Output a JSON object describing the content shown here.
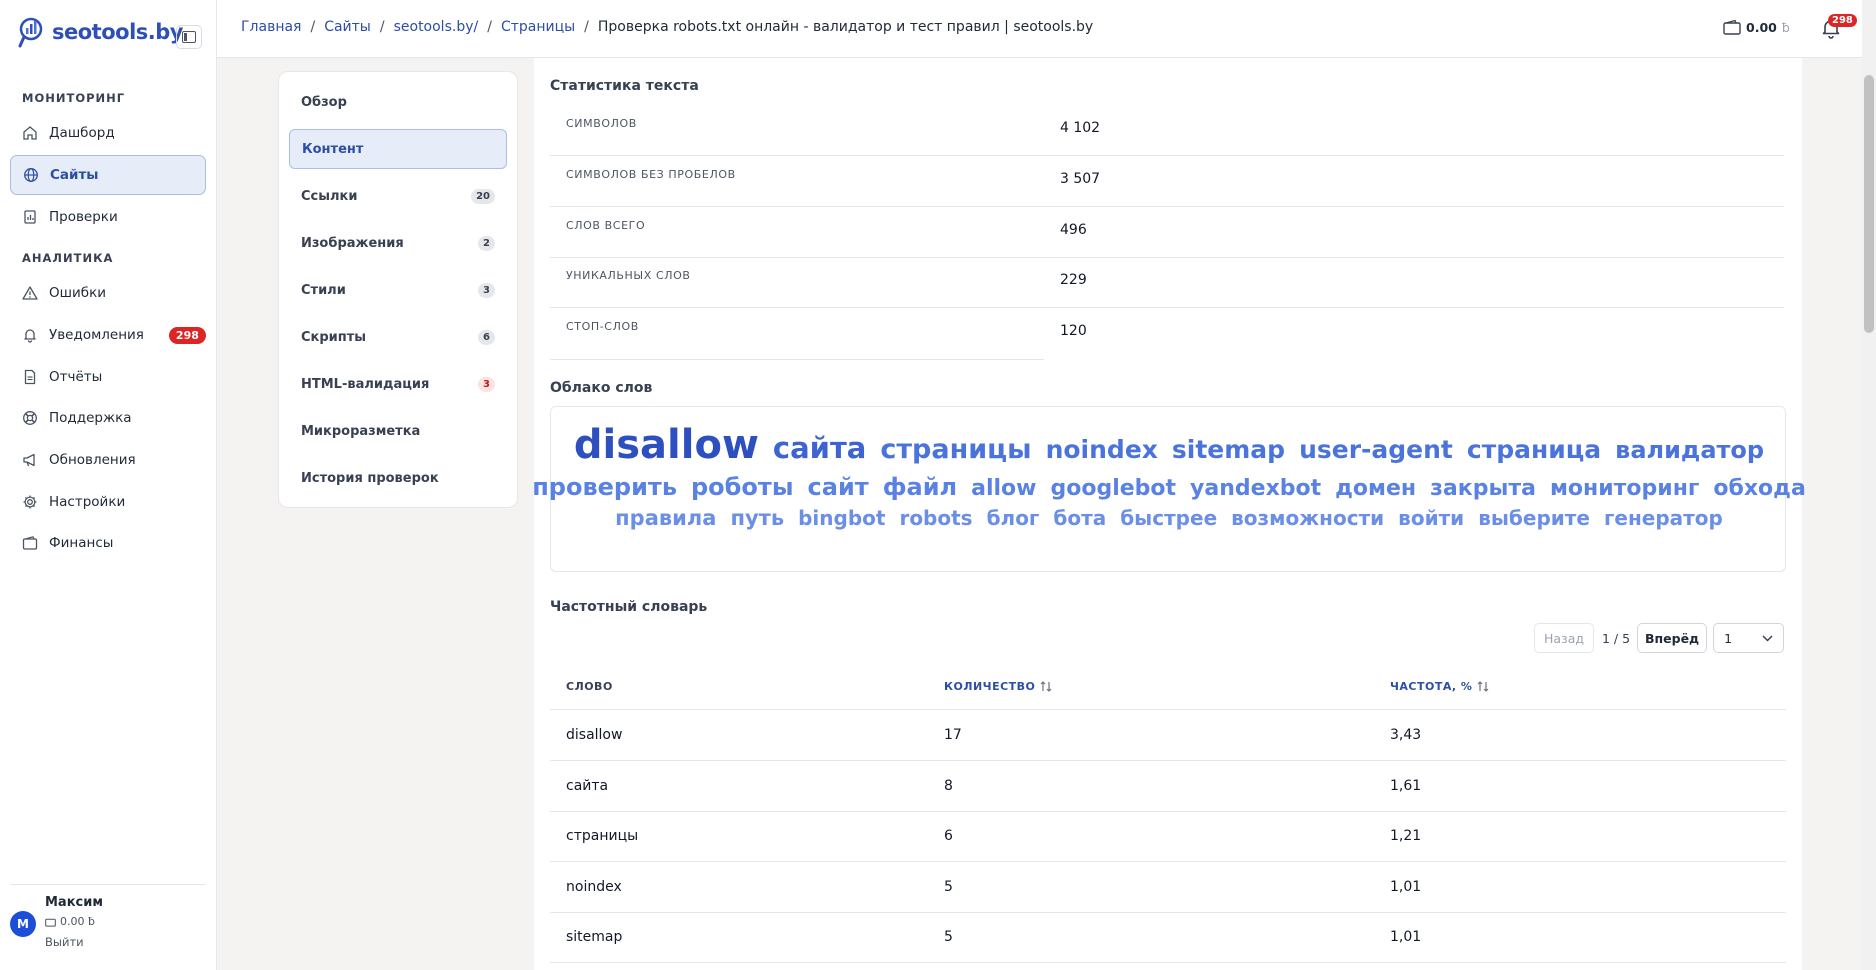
{
  "brand": {
    "name": "seotools.by"
  },
  "sidebar": {
    "sections": [
      {
        "title": "МОНИТОРИНГ"
      },
      {
        "title": "АНАЛИТИКА"
      }
    ],
    "items": [
      {
        "label": "Дашборд",
        "icon": "home-icon"
      },
      {
        "label": "Сайты",
        "icon": "globe-icon",
        "active": true
      },
      {
        "label": "Проверки",
        "icon": "report-icon"
      },
      {
        "label": "Ошибки",
        "icon": "warning-icon"
      },
      {
        "label": "Уведомления",
        "icon": "bell-icon",
        "badge": "298"
      },
      {
        "label": "Отчёты",
        "icon": "document-icon"
      },
      {
        "label": "Поддержка",
        "icon": "lifebuoy-icon"
      },
      {
        "label": "Обновления",
        "icon": "megaphone-icon"
      },
      {
        "label": "Настройки",
        "icon": "gear-icon"
      },
      {
        "label": "Финансы",
        "icon": "wallet-icon"
      }
    ],
    "user": {
      "initial": "М",
      "name": "Максим",
      "balance": "0.00 ƀ",
      "logout": "Выйти"
    }
  },
  "topbar": {
    "breadcrumbs": [
      "Главная",
      "Сайты",
      "seotools.by/",
      "Страницы"
    ],
    "current": "Проверка robots.txt онлайн - валидатор и тест правил | seotools.by",
    "wallet_amount": "0.00",
    "wallet_currency": "ƀ",
    "notifications": "298"
  },
  "tabs": [
    {
      "label": "Обзор"
    },
    {
      "label": "Контент",
      "active": true
    },
    {
      "label": "Ссылки",
      "count": "20"
    },
    {
      "label": "Изображения",
      "count": "2"
    },
    {
      "label": "Стили",
      "count": "3"
    },
    {
      "label": "Скрипты",
      "count": "6"
    },
    {
      "label": "HTML-валидация",
      "count": "3",
      "count_color": "#b91c1c"
    },
    {
      "label": "Микроразметка"
    },
    {
      "label": "История проверок"
    }
  ],
  "text_stats": {
    "title": "Статистика текста",
    "rows": [
      {
        "label": "СИМВОЛОВ",
        "value": "4 102"
      },
      {
        "label": "СИМВОЛОВ БЕЗ ПРОБЕЛОВ",
        "value": "3 507"
      },
      {
        "label": "СЛОВ ВСЕГО",
        "value": "496"
      },
      {
        "label": "УНИКАЛЬНЫХ СЛОВ",
        "value": "229"
      },
      {
        "label": "СТОП-СЛОВ",
        "value": "120"
      }
    ]
  },
  "word_cloud": {
    "title": "Облако слов",
    "lines": [
      [
        {
          "w": "disallow",
          "size": 40,
          "color": "#2d4fbf"
        },
        {
          "w": "сайта",
          "size": 29,
          "color": "#3d64d1"
        },
        {
          "w": "страницы",
          "size": 27,
          "color": "#4a73dc"
        },
        {
          "w": "noindex",
          "size": 25,
          "color": "#4a73dc"
        },
        {
          "w": "sitemap",
          "size": 25,
          "color": "#4a73dc"
        },
        {
          "w": "user-agent",
          "size": 25,
          "color": "#4a73dc"
        },
        {
          "w": "страница",
          "size": 25,
          "color": "#4a73dc"
        },
        {
          "w": "валидатор",
          "size": 24,
          "color": "#4a73dc"
        }
      ],
      [
        {
          "w": "проверить",
          "size": 24,
          "color": "#5a82e2"
        },
        {
          "w": "роботы",
          "size": 24,
          "color": "#5a82e2"
        },
        {
          "w": "сайт",
          "size": 24,
          "color": "#5a82e2"
        },
        {
          "w": "файл",
          "size": 24,
          "color": "#5a82e2"
        },
        {
          "w": "allow",
          "size": 22,
          "color": "#5a82e2"
        },
        {
          "w": "googlebot",
          "size": 22,
          "color": "#5a82e2"
        },
        {
          "w": "yandexbot",
          "size": 22,
          "color": "#5a82e2"
        },
        {
          "w": "домен",
          "size": 22,
          "color": "#5a82e2"
        },
        {
          "w": "закрыта",
          "size": 22,
          "color": "#5a82e2"
        },
        {
          "w": "мониторинг",
          "size": 22,
          "color": "#5a82e2"
        },
        {
          "w": "обхода",
          "size": 22,
          "color": "#5a82e2"
        }
      ],
      [
        {
          "w": "правила",
          "size": 21,
          "color": "#6b8fe6"
        },
        {
          "w": "путь",
          "size": 21,
          "color": "#6b8fe6"
        },
        {
          "w": "bingbot",
          "size": 20,
          "color": "#6b8fe6"
        },
        {
          "w": "robots",
          "size": 20,
          "color": "#6b8fe6"
        },
        {
          "w": "блог",
          "size": 20,
          "color": "#6b8fe6"
        },
        {
          "w": "бота",
          "size": 20,
          "color": "#6b8fe6"
        },
        {
          "w": "быстрее",
          "size": 20,
          "color": "#6b8fe6"
        },
        {
          "w": "возможности",
          "size": 20,
          "color": "#6b8fe6"
        },
        {
          "w": "войти",
          "size": 20,
          "color": "#6b8fe6"
        },
        {
          "w": "выберите",
          "size": 20,
          "color": "#6b8fe6"
        },
        {
          "w": "генератор",
          "size": 20,
          "color": "#6b8fe6"
        }
      ]
    ]
  },
  "freq": {
    "title": "Частотный словарь",
    "pager": {
      "prev": "Назад",
      "info": "1 / 5",
      "next": "Вперёд",
      "page": "1"
    },
    "columns": [
      "СЛОВО",
      "КОЛИЧЕСТВО",
      "ЧАСТОТА, %"
    ],
    "rows": [
      [
        "disallow",
        "17",
        "3,43"
      ],
      [
        "сайта",
        "8",
        "1,61"
      ],
      [
        "страницы",
        "6",
        "1,21"
      ],
      [
        "noindex",
        "5",
        "1,01"
      ],
      [
        "sitemap",
        "5",
        "1,01"
      ]
    ]
  }
}
